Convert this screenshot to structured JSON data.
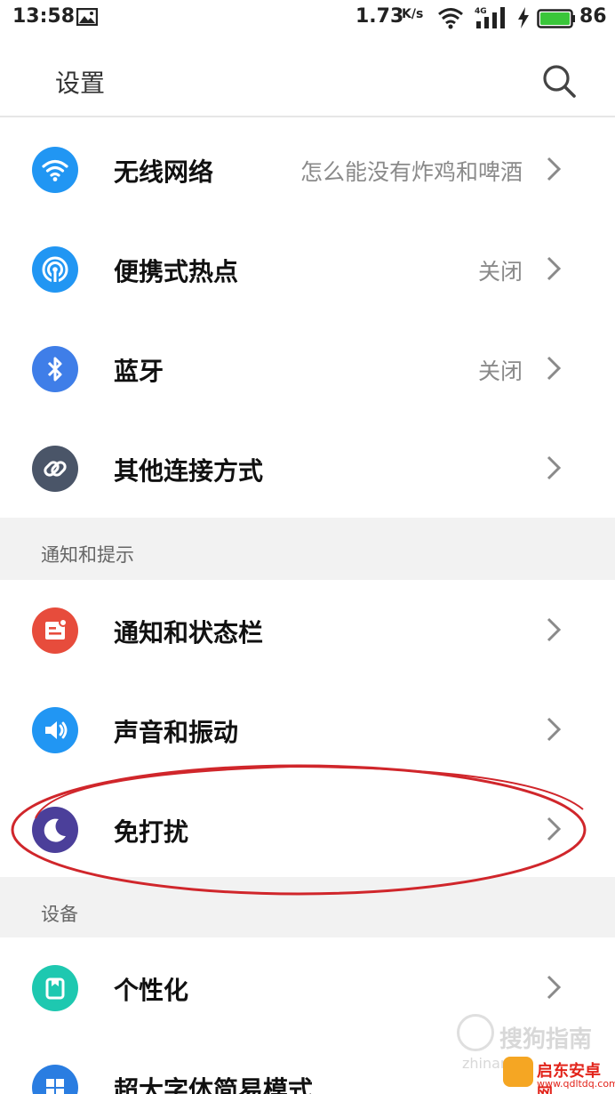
{
  "status_bar": {
    "time": "13:58",
    "speed": "1.73",
    "speed_unit": "K/s",
    "network": "4G",
    "battery": "86"
  },
  "header": {
    "title": "设置"
  },
  "rows": [
    {
      "label": "无线网络",
      "value": "怎么能没有炸鸡和啤酒",
      "icon": "wifi-icon",
      "color": "#2196f3"
    },
    {
      "label": "便携式热点",
      "value": "关闭",
      "icon": "hotspot-icon",
      "color": "#2196f3"
    },
    {
      "label": "蓝牙",
      "value": "关闭",
      "icon": "bluetooth-icon",
      "color": "#3f7ee8"
    },
    {
      "label": "其他连接方式",
      "value": "",
      "icon": "link-icon",
      "color": "#4a5568"
    },
    {
      "label": "通知和状态栏",
      "value": "",
      "icon": "notification-icon",
      "color": "#e74c3c"
    },
    {
      "label": "声音和振动",
      "value": "",
      "icon": "sound-icon",
      "color": "#2196f3"
    },
    {
      "label": "免打扰",
      "value": "",
      "icon": "moon-icon",
      "color": "#4b3f9a"
    },
    {
      "label": "个性化",
      "value": "",
      "icon": "personalize-icon",
      "color": "#1ec8b0"
    },
    {
      "label": "超大字体简易模式",
      "value": "",
      "icon": "simple-mode-icon",
      "color": "#2a7de1"
    }
  ],
  "sections": [
    {
      "label": "通知和提示"
    },
    {
      "label": "设备"
    }
  ],
  "watermark": {
    "line1": "搜狗指南",
    "line2": "zhinan",
    "brand": "启东安卓网",
    "site": "www.qdltdq.com"
  },
  "colors": {
    "annotation": "#d0262b",
    "section_bg": "#f2f2f2"
  }
}
